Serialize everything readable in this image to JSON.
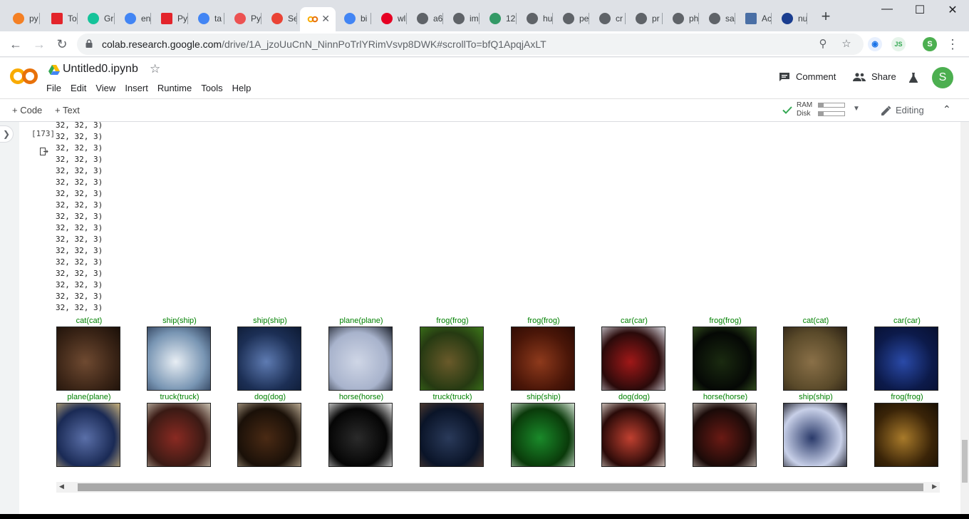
{
  "tabs": [
    {
      "label": "py",
      "icon": "stackoverflow-icon",
      "color": "#f48024"
    },
    {
      "label": "To",
      "icon": "vivaldi-icon",
      "color": "#e3242b"
    },
    {
      "label": "Gr",
      "icon": "grammarly-icon",
      "color": "#15c39a"
    },
    {
      "label": "en",
      "icon": "google-icon",
      "color": "#4285f4"
    },
    {
      "label": "Py",
      "icon": "vivaldi-icon",
      "color": "#e3242b"
    },
    {
      "label": "ta",
      "icon": "google-icon",
      "color": "#4285f4"
    },
    {
      "label": "Py",
      "icon": "udemy-icon",
      "color": "#ec5252"
    },
    {
      "label": "Se",
      "icon": "gmail-icon",
      "color": "#ea4335"
    },
    {
      "label": "",
      "icon": "colab-icon",
      "color": "#f9ab00"
    },
    {
      "label": "bi",
      "icon": "google-icon",
      "color": "#4285f4"
    },
    {
      "label": "wl",
      "icon": "pinterest-icon",
      "color": "#e60023"
    },
    {
      "label": "a6",
      "icon": "globe-icon",
      "color": "#5f6368"
    },
    {
      "label": "im",
      "icon": "globe-icon",
      "color": "#5f6368"
    },
    {
      "label": "12",
      "icon": "wiki-icon",
      "color": "#339966"
    },
    {
      "label": "hu",
      "icon": "globe-icon",
      "color": "#5f6368"
    },
    {
      "label": "pe",
      "icon": "globe-icon",
      "color": "#5f6368"
    },
    {
      "label": "cr",
      "icon": "globe-icon",
      "color": "#5f6368"
    },
    {
      "label": "pr",
      "icon": "globe-icon",
      "color": "#5f6368"
    },
    {
      "label": "ph",
      "icon": "globe-icon",
      "color": "#5f6368"
    },
    {
      "label": "sa",
      "icon": "globe-icon",
      "color": "#5f6368"
    },
    {
      "label": "Ac",
      "icon": "doc-icon",
      "color": "#4a6fa5"
    },
    {
      "label": "nu",
      "icon": "s-icon",
      "color": "#1a3d8f"
    }
  ],
  "address": {
    "host": "colab.research.google.com",
    "path": "/drive/1A_jzoUuCnN_NinnPoTrlYRimVsvp8DWK#scrollTo=bfQ1ApqjAxLT"
  },
  "notebook": {
    "title": "Untitled0.ipynb",
    "menu": [
      "File",
      "Edit",
      "View",
      "Insert",
      "Runtime",
      "Tools",
      "Help"
    ],
    "comment_label": "Comment",
    "share_label": "Share",
    "avatar_letter": "S"
  },
  "toolbar": {
    "code_label": "+ Code",
    "text_label": "+ Text",
    "ram_label": "RAM",
    "disk_label": "Disk",
    "ram_usage": 0.2,
    "disk_usage": 0.2,
    "editing_label": "Editing"
  },
  "cell": {
    "exec_count": "[173]",
    "shape_lines": [
      "32, 32, 3)",
      "32, 32, 3)",
      "32, 32, 3)",
      "32, 32, 3)",
      "32, 32, 3)",
      "32, 32, 3)",
      "32, 32, 3)",
      "32, 32, 3)",
      "32, 32, 3)",
      "32, 32, 3)",
      "32, 32, 3)",
      "32, 32, 3)",
      "32, 32, 3)",
      "32, 32, 3)",
      "32, 32, 3)",
      "32, 32, 3)",
      "32, 32, 3)"
    ],
    "row1": [
      "cat(cat)",
      "ship(ship)",
      "ship(ship)",
      "plane(plane)",
      "frog(frog)",
      "frog(frog)",
      "car(car)",
      "frog(frog)",
      "cat(cat)",
      "car(car)"
    ],
    "row2": [
      "plane(plane)",
      "truck(truck)",
      "dog(dog)",
      "horse(horse)",
      "truck(truck)",
      "ship(ship)",
      "dog(dog)",
      "horse(horse)",
      "ship(ship)",
      "frog(frog)"
    ]
  },
  "colors": {
    "label_green": "#008000",
    "colab_orange": "#f9ab00",
    "avatar_green": "#4caf50"
  }
}
